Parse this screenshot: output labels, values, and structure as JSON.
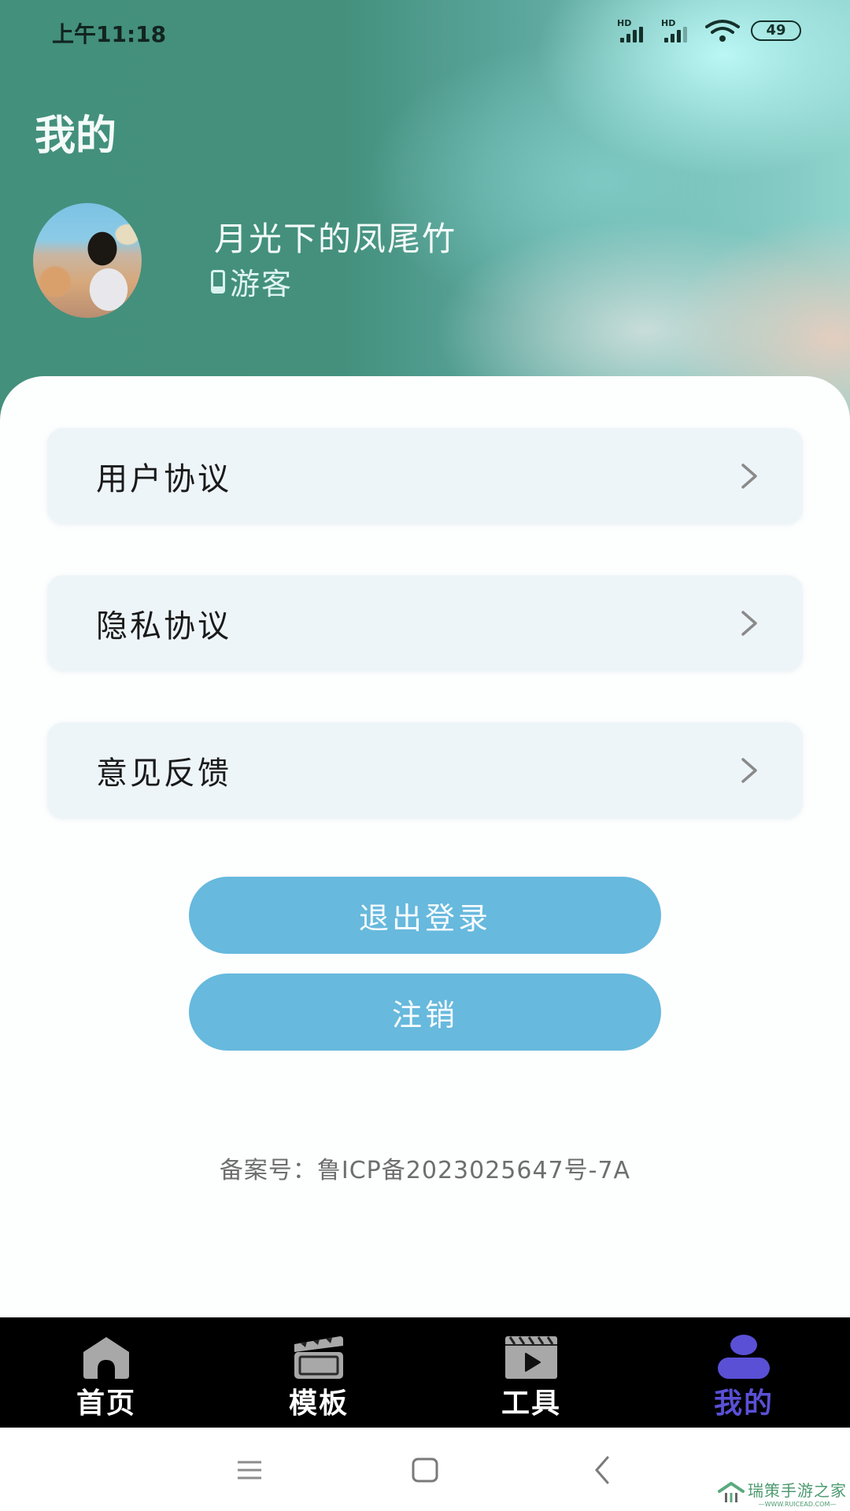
{
  "status_bar": {
    "time": "上午11:18",
    "signal1_label": "HD",
    "signal2_label": "HD",
    "battery": "49"
  },
  "header": {
    "title": "我的",
    "user_name": "月光下的凤尾竹",
    "user_role": "游客"
  },
  "menu": {
    "items": [
      {
        "label": "用户协议"
      },
      {
        "label": "隐私协议"
      },
      {
        "label": "意见反馈"
      }
    ]
  },
  "actions": {
    "logout_label": "退出登录",
    "deregister_label": "注销"
  },
  "footer": {
    "icp": "备案号：鲁ICP备2023025647号-7A"
  },
  "tabbar": {
    "active": "我的",
    "active_color": "#5a50d6",
    "tabs": [
      {
        "label": "首页",
        "icon": "home-icon"
      },
      {
        "label": "模板",
        "icon": "clapperboard-icon"
      },
      {
        "label": "工具",
        "icon": "video-play-icon"
      },
      {
        "label": "我的",
        "icon": "person-icon"
      }
    ]
  },
  "watermark": {
    "title": "瑞策手游之家",
    "url": "—WWW.RUICEAD.COM—"
  },
  "colors": {
    "button": "#67b9dd",
    "header_green": "#43907c",
    "menu_bg": "#eef5f9"
  }
}
